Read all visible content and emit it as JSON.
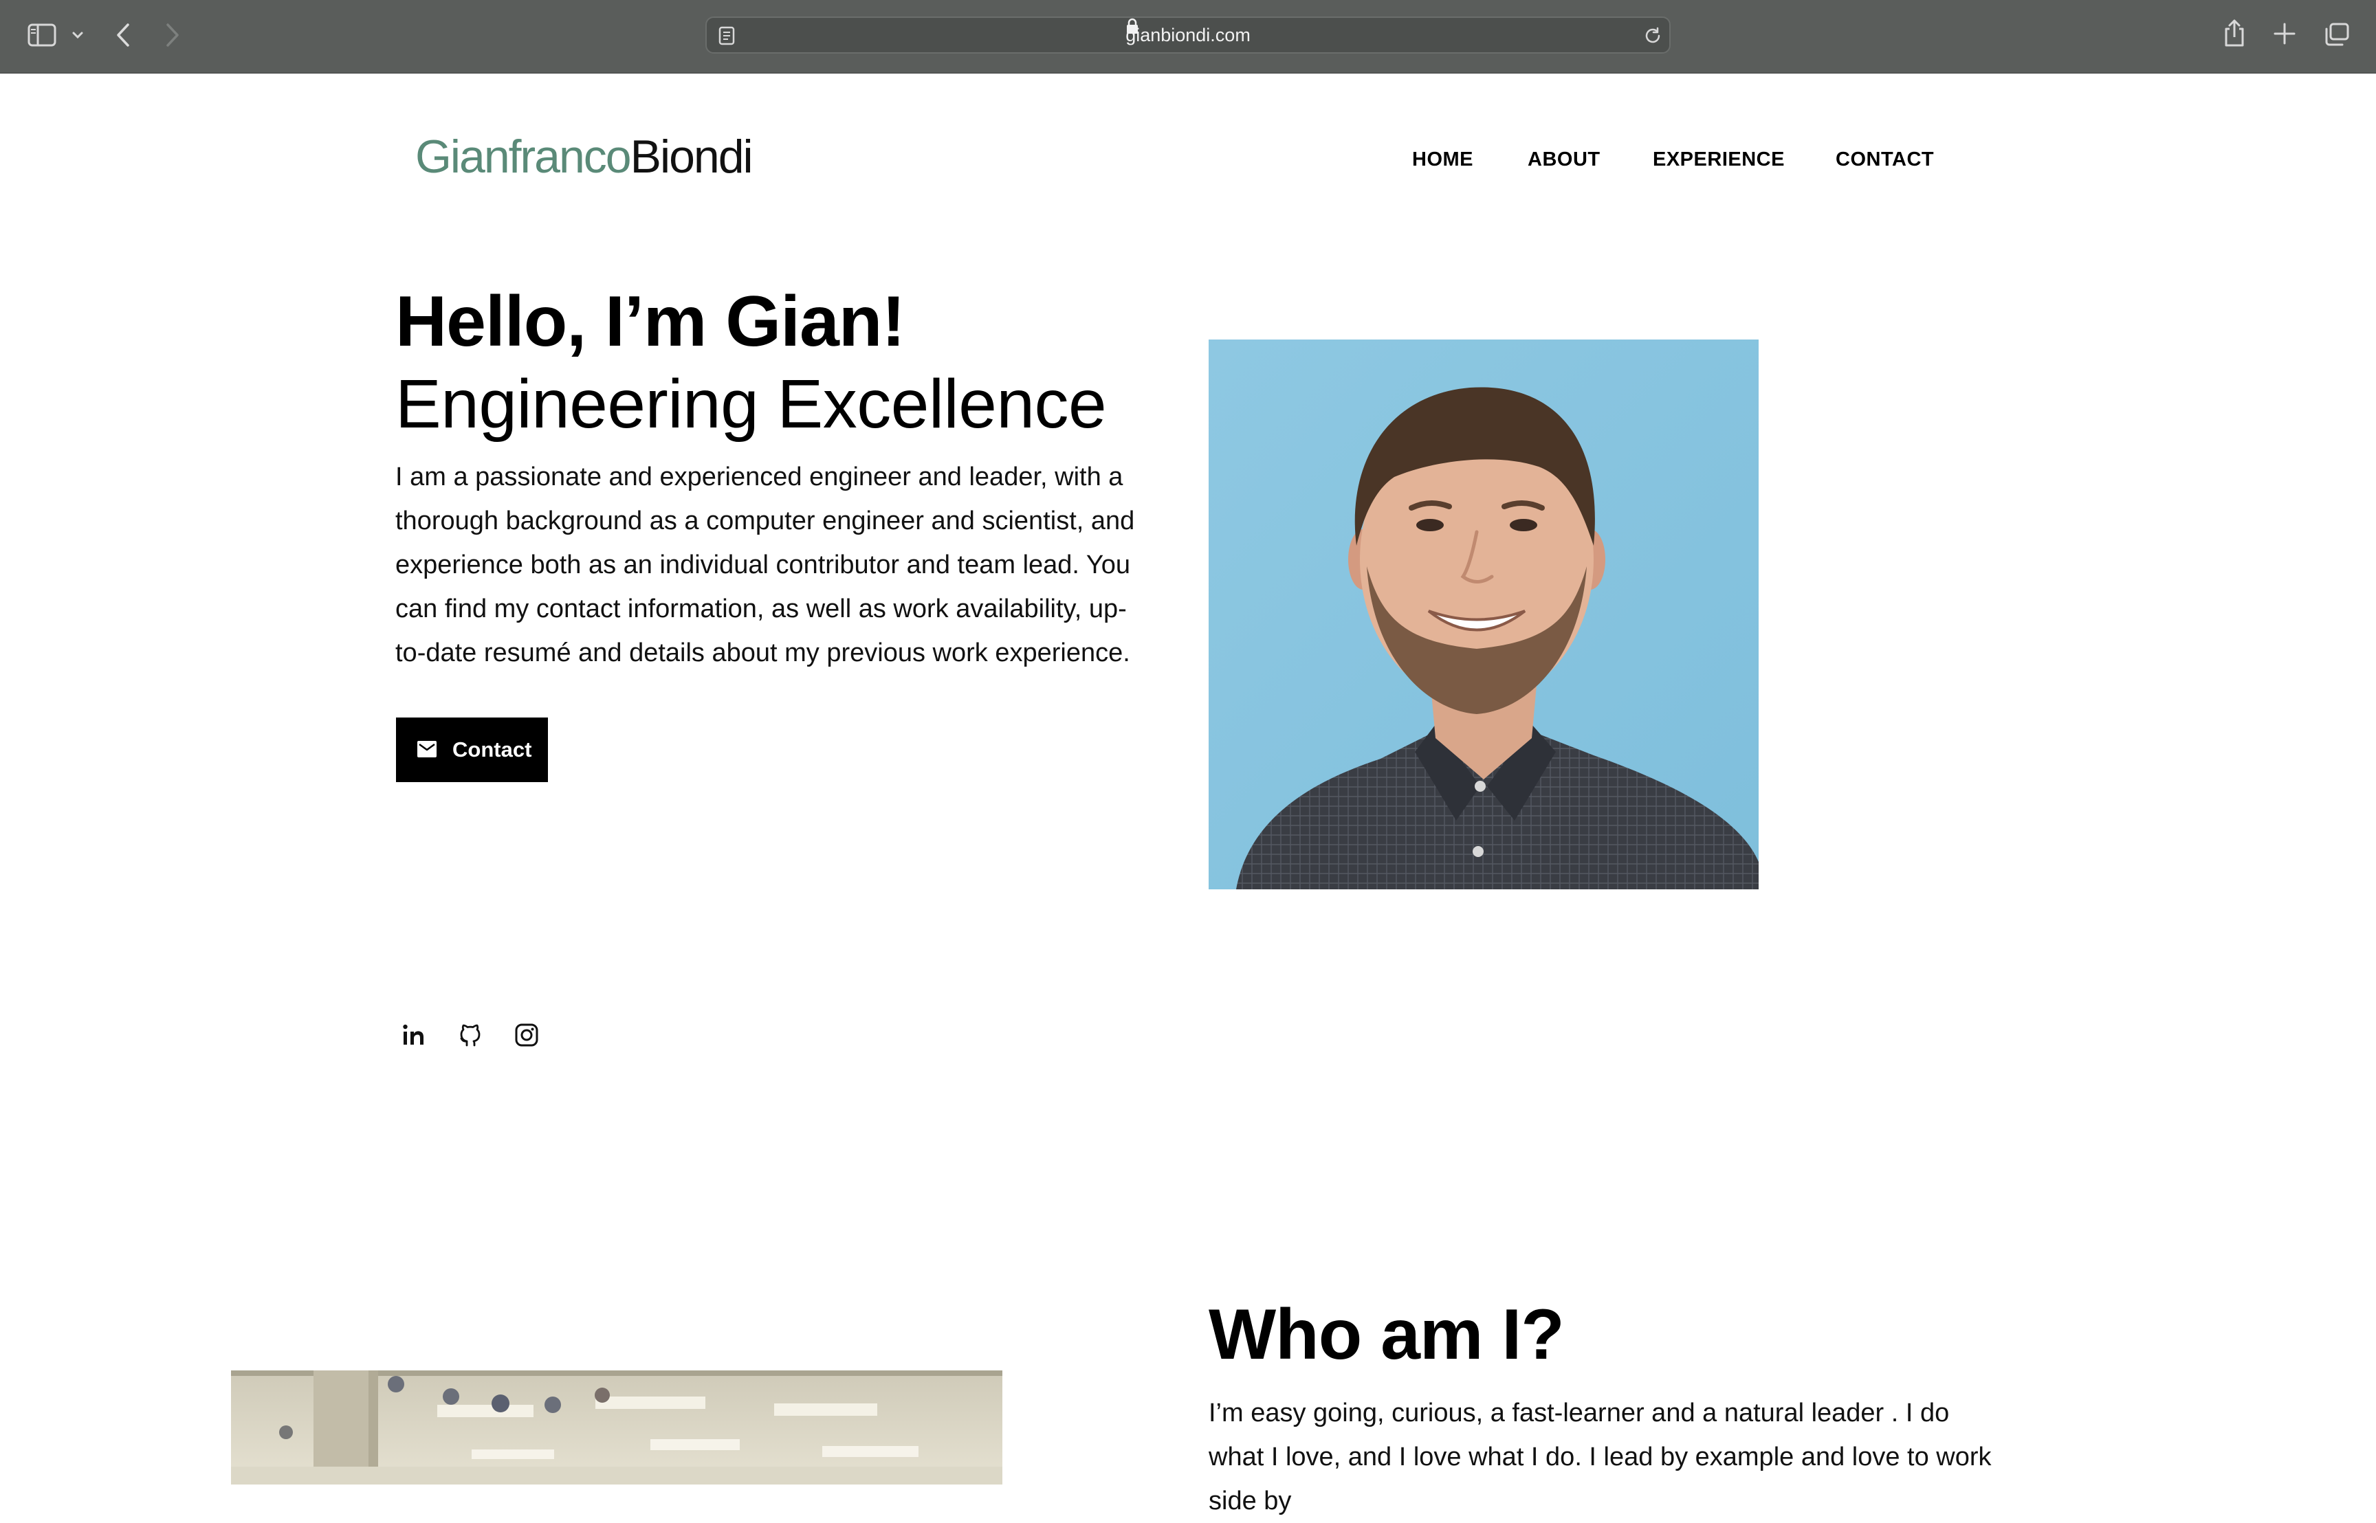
{
  "browser": {
    "url": "gianbiondi.com"
  },
  "site": {
    "logo_first": "Gianfranco",
    "logo_last": "Biondi",
    "brand_color": "#5a8a78",
    "nav": [
      {
        "label": "HOME"
      },
      {
        "label": "ABOUT"
      },
      {
        "label": "EXPERIENCE"
      },
      {
        "label": "CONTACT"
      }
    ]
  },
  "hero": {
    "title": "Hello, I’m Gian!",
    "subtitle": "Engineering Excellence",
    "body": "I am a passionate and experienced engineer and leader, with a thorough background as a computer engineer and scientist, and experience both as an individual contributor and team lead. You can find my contact information, as well as work availability, up-to-date resumé and details about my previous work experience.",
    "contact_button": "Contact"
  },
  "social": [
    {
      "icon": "linkedin-icon"
    },
    {
      "icon": "github-icon"
    },
    {
      "icon": "instagram-icon"
    }
  ],
  "about": {
    "title": "Who am I?",
    "body": "I’m easy going, curious, a fast-learner and a natural leader . I do what I love, and I love what I do. I lead by example and love to work side by"
  }
}
